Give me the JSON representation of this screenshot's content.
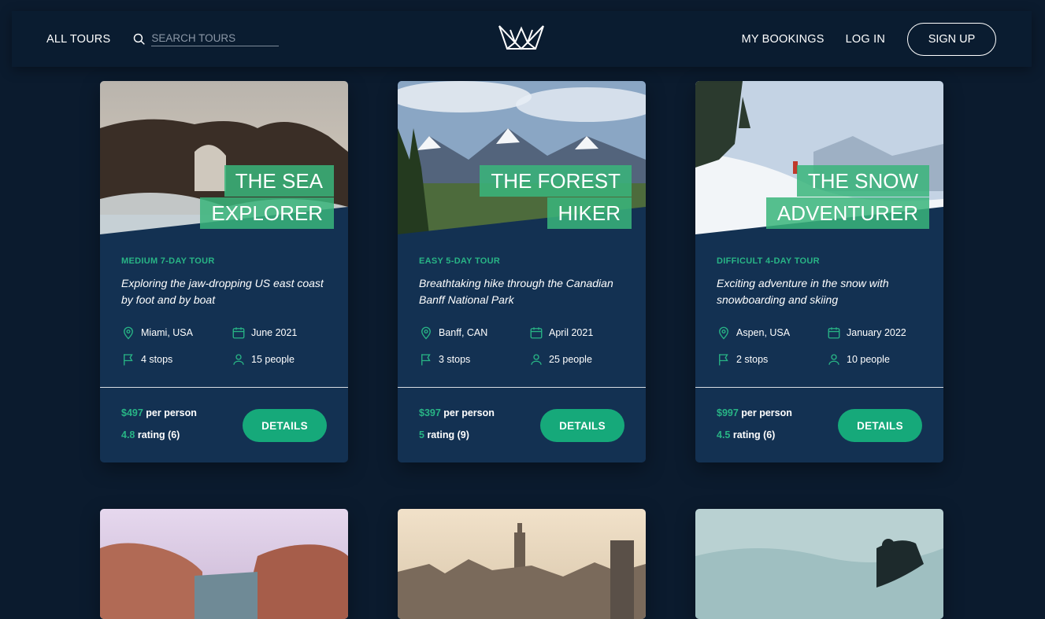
{
  "header": {
    "all_tours": "ALL TOURS",
    "search_placeholder": "SEARCH TOURS",
    "my_bookings": "MY BOOKINGS",
    "log_in": "LOG IN",
    "sign_up": "SIGN UP"
  },
  "tours": [
    {
      "name_line1": "THE SEA",
      "name_line2": "EXPLORER",
      "subheading": "MEDIUM 7-DAY TOUR",
      "summary": "Exploring the jaw-dropping US east coast by foot and by boat",
      "location": "Miami, USA",
      "date": "June 2021",
      "stops": "4 stops",
      "people": "15 people",
      "price": "$497",
      "price_suffix": "per person",
      "rating": "4.8",
      "rating_suffix": "rating (6)",
      "button": "DETAILS"
    },
    {
      "name_line1": "THE FOREST",
      "name_line2": "HIKER",
      "subheading": "EASY 5-DAY TOUR",
      "summary": "Breathtaking hike through the Canadian Banff National Park",
      "location": "Banff, CAN",
      "date": "April 2021",
      "stops": "3 stops",
      "people": "25 people",
      "price": "$397",
      "price_suffix": "per person",
      "rating": "5",
      "rating_suffix": "rating (9)",
      "button": "DETAILS"
    },
    {
      "name_line1": "THE SNOW",
      "name_line2": "ADVENTURER",
      "subheading": "DIFFICULT 4-DAY TOUR",
      "summary": "Exciting adventure in the snow with snowboarding and skiing",
      "location": "Aspen, USA",
      "date": "January 2022",
      "stops": "2 stops",
      "people": "10 people",
      "price": "$997",
      "price_suffix": "per person",
      "rating": "4.5",
      "rating_suffix": "rating (6)",
      "button": "DETAILS"
    }
  ],
  "icons": {
    "search": "search-icon",
    "logo": "crown-logo",
    "location": "map-pin-icon",
    "date": "calendar-icon",
    "stops": "flag-icon",
    "people": "user-icon"
  },
  "colors": {
    "background": "#0b1b2e",
    "header": "#0a1c30",
    "card": "#133152",
    "accent": "#28b485",
    "button": "#16a97a"
  }
}
